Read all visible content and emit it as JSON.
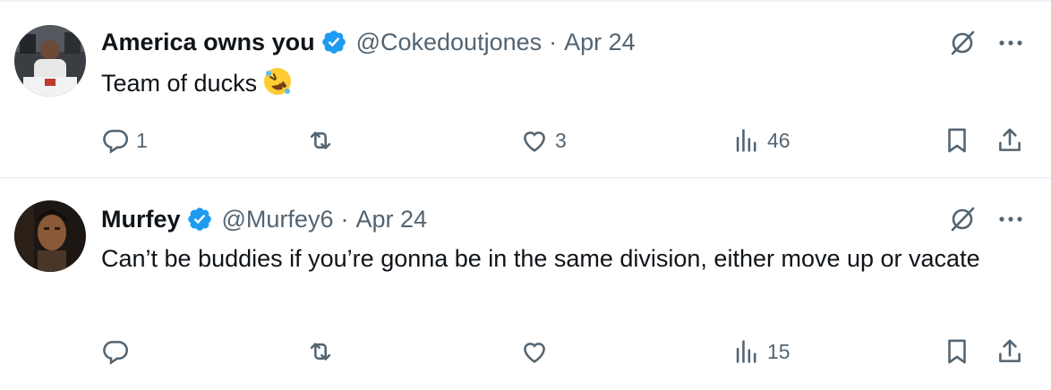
{
  "tweets": [
    {
      "display_name": "America owns you",
      "handle": "@Cokedoutjones",
      "separator": "·",
      "date": "Apr 24",
      "text": "Team of ducks",
      "emoji": "rolling-on-floor-laughing-emoji",
      "reply_count": "1",
      "like_count": "3",
      "view_count": "46"
    },
    {
      "display_name": "Murfey",
      "handle": "@Murfey6",
      "separator": "·",
      "date": "Apr 24",
      "text": "Can’t be buddies if you’re gonna be in the same division, either move up or vacate",
      "reply_count": "",
      "like_count": "",
      "view_count": "15"
    }
  ],
  "colors": {
    "verified": "#1d9bf0",
    "secondary_text": "#536471",
    "divider": "#eff3f4"
  }
}
